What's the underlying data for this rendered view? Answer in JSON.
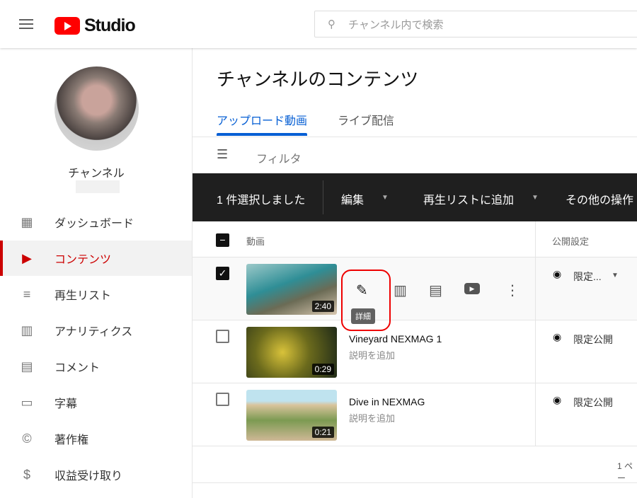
{
  "header": {
    "logo_text": "Studio",
    "search_placeholder": "チャンネル内で検索"
  },
  "sidebar": {
    "channel_name": "チャンネル",
    "items": [
      {
        "label": "ダッシュボード",
        "icon": "dashboard-icon"
      },
      {
        "label": "コンテンツ",
        "icon": "content-icon",
        "active": true
      },
      {
        "label": "再生リスト",
        "icon": "playlist-icon"
      },
      {
        "label": "アナリティクス",
        "icon": "analytics-icon"
      },
      {
        "label": "コメント",
        "icon": "comment-icon"
      },
      {
        "label": "字幕",
        "icon": "subtitles-icon"
      },
      {
        "label": "著作権",
        "icon": "copyright-icon"
      },
      {
        "label": "収益受け取り",
        "icon": "dollar-icon"
      }
    ]
  },
  "main": {
    "title": "チャンネルのコンテンツ",
    "tabs": [
      "アップロード動画",
      "ライブ配信"
    ],
    "filter": "フィルタ",
    "selection_bar": {
      "count": "1 件選択しました",
      "edit": "編集",
      "add_playlist": "再生リストに追加",
      "more": "その他の操作"
    },
    "columns": {
      "video": "動画",
      "visibility": "公開設定"
    },
    "tooltip": "詳細",
    "rows": [
      {
        "title": "",
        "description": "",
        "duration": "2:40",
        "visibility": "限定...",
        "checked": true
      },
      {
        "title": "Vineyard NEXMAG 1",
        "description": "説明を追加",
        "duration": "0:29",
        "visibility": "限定公開",
        "checked": false
      },
      {
        "title": "Dive in NEXMAG",
        "description": "説明を追加",
        "duration": "0:21",
        "visibility": "限定公開",
        "checked": false
      }
    ],
    "pagination": "1 ペー"
  }
}
